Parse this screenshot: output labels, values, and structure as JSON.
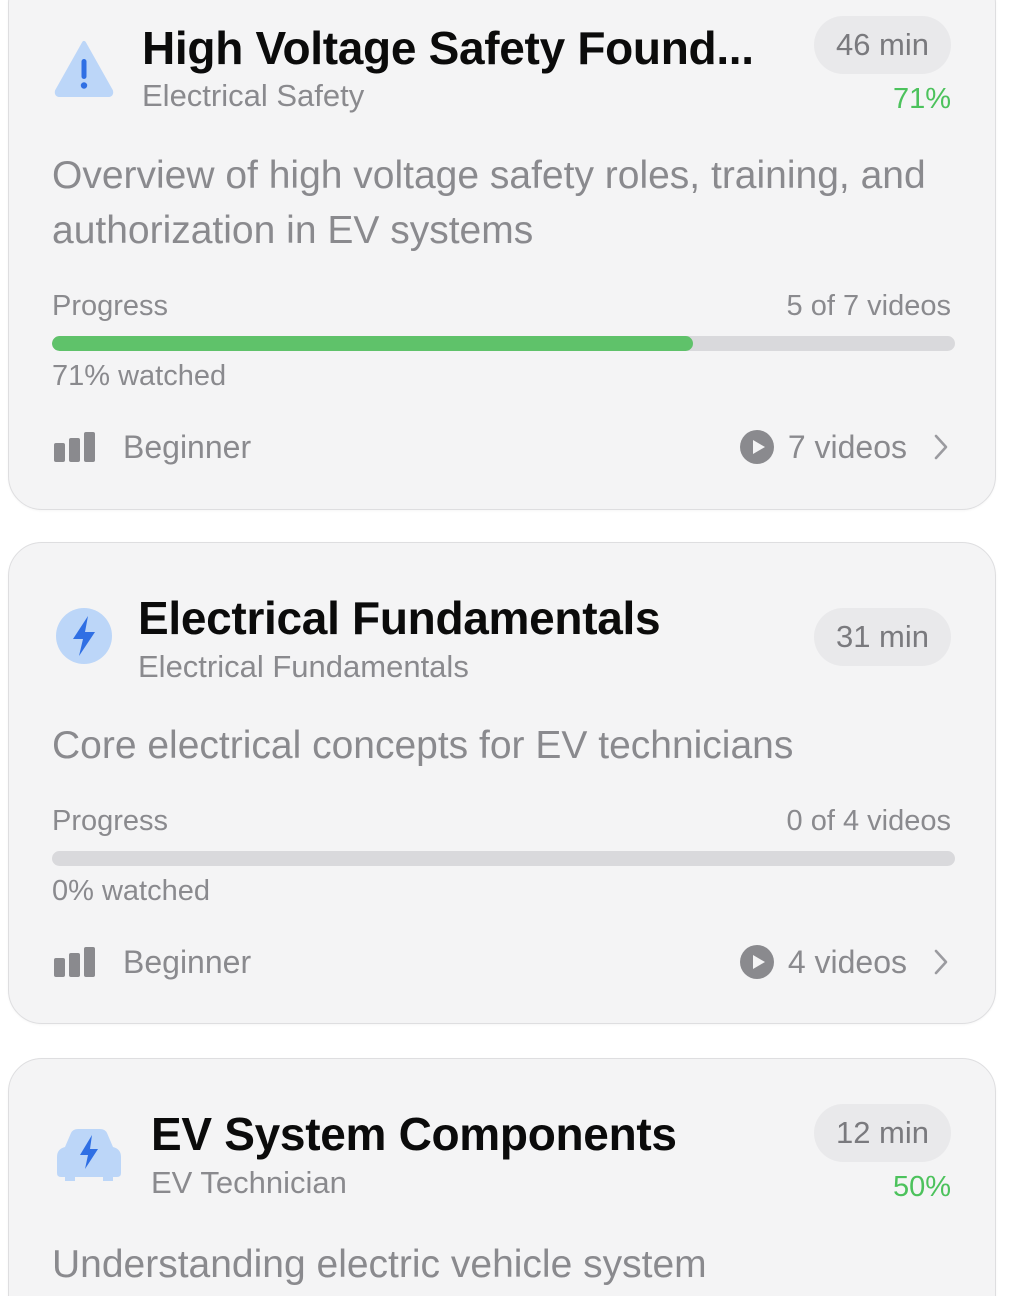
{
  "colors": {
    "accent_green": "#4cc25c",
    "progress_fill": "#5fc26a",
    "icon_blue": "#3a7bf0",
    "icon_bg_blue": "#bcd6f8",
    "muted_text": "#8a8a8e"
  },
  "courses": [
    {
      "icon": "warning-triangle-icon",
      "title": "High Voltage Safety Found...",
      "category": "Electrical Safety",
      "duration": "46 min",
      "percent": "71%",
      "description": "Overview of high voltage safety roles, training, and authorization in EV systems",
      "progress_label": "Progress",
      "progress_count": "5 of 7 videos",
      "progress_fraction": 0.71,
      "watched": "71% watched",
      "level_icon": "signal-bars-icon",
      "level": "Beginner",
      "videos": "7 videos"
    },
    {
      "icon": "lightning-bolt-icon",
      "title": "Electrical Fundamentals",
      "category": "Electrical Fundamentals",
      "duration": "31 min",
      "description": "Core electrical concepts for EV technicians",
      "progress_label": "Progress",
      "progress_count": "0 of 4 videos",
      "progress_fraction": 0.0,
      "watched": "0% watched",
      "level_icon": "signal-bars-icon",
      "level": "Beginner",
      "videos": "4 videos"
    },
    {
      "icon": "electric-car-icon",
      "title": "EV System Components",
      "category": "EV Technician",
      "duration": "12 min",
      "percent": "50%",
      "description": "Understanding electric vehicle system"
    }
  ]
}
